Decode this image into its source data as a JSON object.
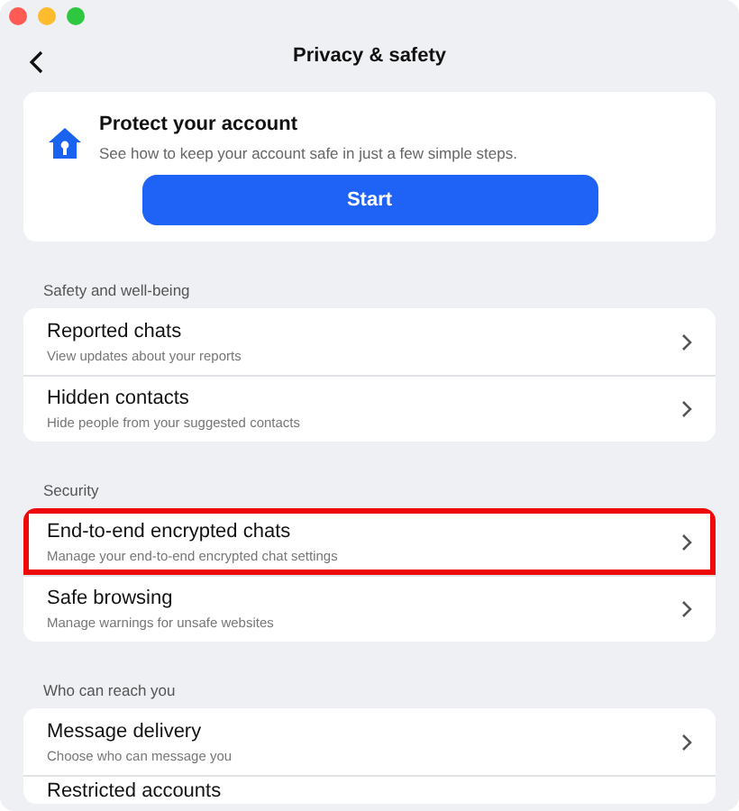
{
  "window": {
    "title": "Privacy & safety"
  },
  "promo": {
    "title": "Protect your account",
    "description": "See how to keep your account safe in just a few simple steps.",
    "button": "Start"
  },
  "sections": [
    {
      "heading": "Safety and well-being",
      "items": [
        {
          "title": "Reported chats",
          "subtitle": "View updates about your reports",
          "highlighted": false
        },
        {
          "title": "Hidden contacts",
          "subtitle": "Hide people from your suggested contacts",
          "highlighted": false
        }
      ]
    },
    {
      "heading": "Security",
      "items": [
        {
          "title": "End-to-end encrypted chats",
          "subtitle": "Manage your end-to-end encrypted chat settings",
          "highlighted": true
        },
        {
          "title": "Safe browsing",
          "subtitle": "Manage warnings for unsafe websites",
          "highlighted": false
        }
      ]
    },
    {
      "heading": "Who can reach you",
      "items": [
        {
          "title": "Message delivery",
          "subtitle": "Choose who can message you",
          "highlighted": false
        },
        {
          "title": "Restricted accounts",
          "highlighted": false
        }
      ]
    }
  ]
}
